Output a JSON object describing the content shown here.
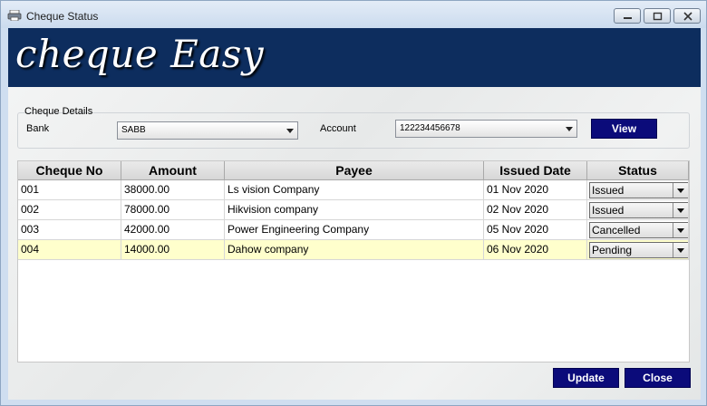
{
  "window": {
    "title": "Cheque Status",
    "banner_text": "cheque Easy"
  },
  "cheque_details": {
    "legend": "Cheque Details",
    "bank_label": "Bank",
    "bank_value": "SABB",
    "account_label": "Account",
    "account_value": "122234456678",
    "view_label": "View"
  },
  "grid": {
    "columns": [
      "Cheque  No",
      "Amount",
      "Payee",
      "Issued Date",
      "Status"
    ],
    "rows": [
      {
        "no": "001",
        "amount": "38000.00",
        "payee": "Ls vision Company",
        "date": "01 Nov 2020",
        "status": "Issued"
      },
      {
        "no": "002",
        "amount": "78000.00",
        "payee": "Hikvision company",
        "date": "02 Nov 2020",
        "status": "Issued"
      },
      {
        "no": "003",
        "amount": "42000.00",
        "payee": "Power Engineering Company",
        "date": "05 Nov 2020",
        "status": "Cancelled"
      },
      {
        "no": "004",
        "amount": "14000.00",
        "payee": "Dahow company",
        "date": "06 Nov 2020",
        "status": "Pending"
      }
    ],
    "selected_row": 3
  },
  "footer": {
    "update_label": "Update",
    "close_label": "Close"
  },
  "colors": {
    "banner": "#0d2d5e",
    "button": "#0b0b7a",
    "selected_row": "#ffffcc"
  }
}
